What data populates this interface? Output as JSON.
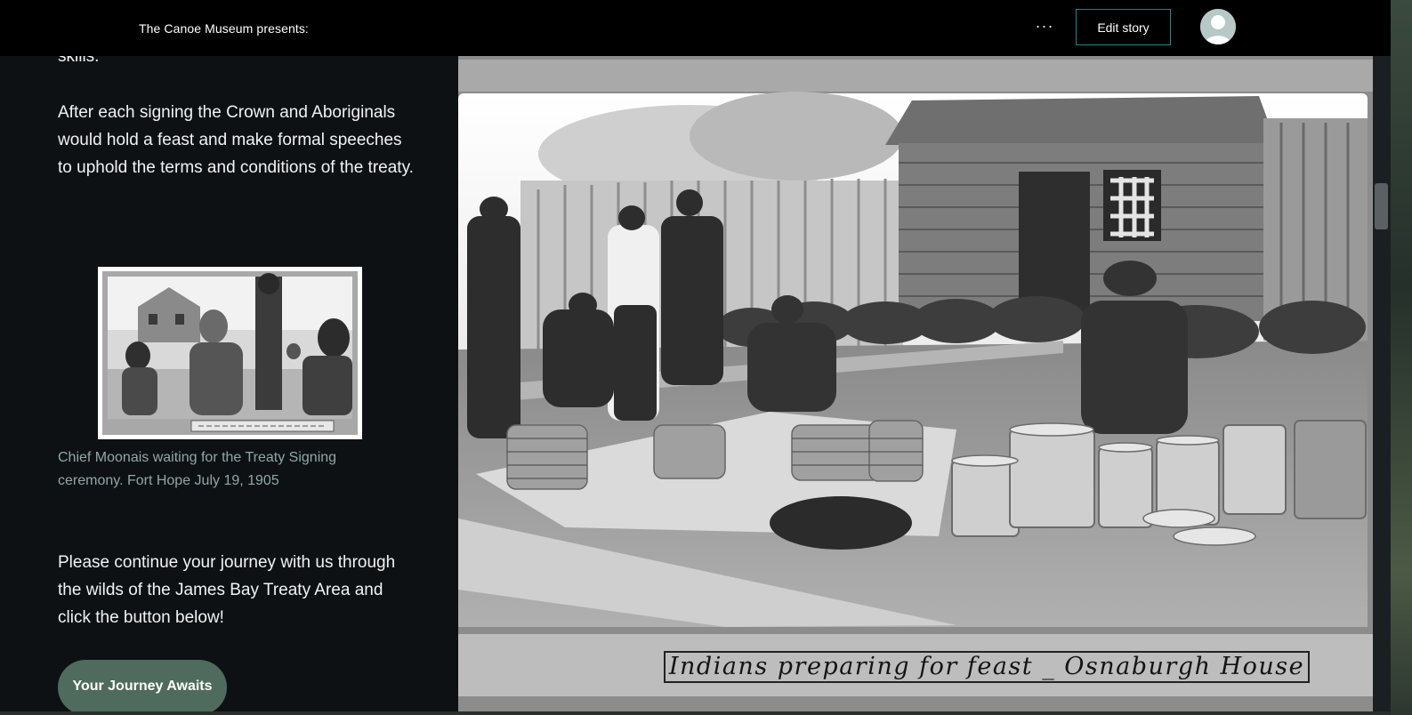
{
  "header": {
    "brand": "The Canoe Museum presents:",
    "more_icon": "···",
    "edit_label": "Edit story",
    "avatar_icon": "user-avatar-icon"
  },
  "panel": {
    "top_fragment": "skills.",
    "paragraph1": "After each signing the Crown and Aboriginals would hold a feast and make formal speeches to uphold the terms and conditions of the treaty.",
    "thumb_caption": "Chief Moonais waiting for the Treaty Signing ceremony. Fort Hope July 19, 1905",
    "paragraph2": "Please continue your journey with us through the wilds of the James Bay Treaty Area and click the button below!",
    "button_label": "Your Journey Awaits"
  },
  "main": {
    "photo_caption": "Indians preparing for feast _ Osnaburgh House"
  },
  "colors": {
    "header_bg": "#000000",
    "panel_bg": "#0e1114",
    "accent_border": "#1f8a8a",
    "button_bg": "#4f6b5e",
    "caption_text": "#8fa8a6"
  }
}
